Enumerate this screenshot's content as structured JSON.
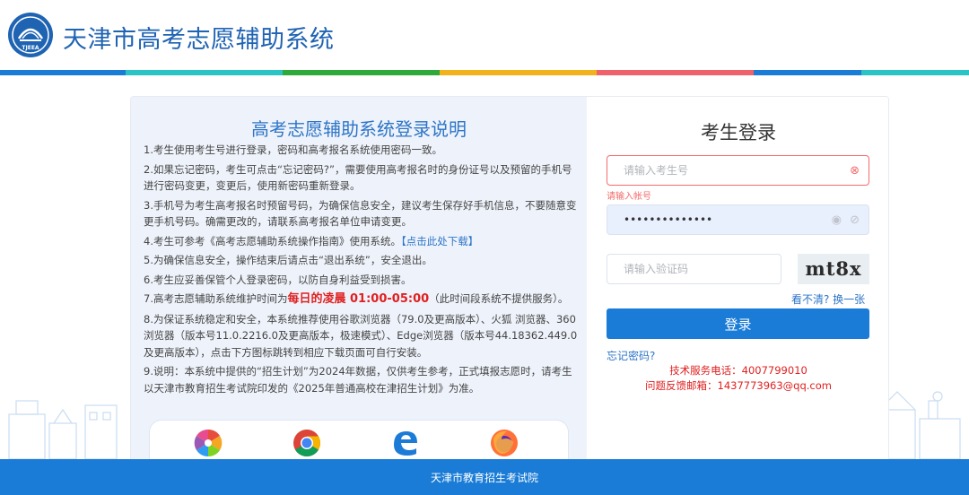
{
  "header": {
    "site_title": "天津市高考志愿辅助系统",
    "stripe_colors": [
      "#1a7cd6",
      "#2bc4c4",
      "#2eaa3a",
      "#f2b21b",
      "#f0626b",
      "#1a7cd6",
      "#2bc4c4"
    ]
  },
  "notice": {
    "title": "高考志愿辅助系统登录说明",
    "items": [
      "1.考生使用考生号进行登录，密码和高考报名系统使用密码一致。",
      "2.如果忘记密码，考生可点击“忘记密码?”，需要使用高考报名时的身份证号以及预留的手机号进行密码变更，变更后，使用新密码重新登录。",
      "3.手机号为考生高考报名时预留号码，为确保信息安全，建议考生保存好手机信息，不要随意变更手机号码。确需更改的，请联系高考报名单位申请变更。",
      "4.考生可参考《高考志愿辅助系统操作指南》使用系统。",
      "5.为确保信息安全，操作结束后请点击“退出系统”，安全退出。",
      "6.考生应妥善保管个人登录密码，以防自身利益受到损害。",
      "7.高考志愿辅助系统维护时间为",
      "8.为保证系统稳定和安全，本系统推荐使用谷歌浏览器（79.0及更高版本）、火狐 浏览器、360浏览器（版本号11.0.2216.0及更高版本，极速模式）、Edge浏览器（版本号44.18362.449.0及更高版本），点击下方图标跳转到相应下载页面可自行安装。",
      "9.说明：本系统中提供的“招生计划”为2024年数据，仅供考生参考，正式填报志愿时，请考生以天津市教育招生考试院印发的《2025年普通高校在津招生计划》为准。"
    ],
    "item4_link": "【点击此处下载】",
    "item7_highlight": "每日的凌晨 01:00-05:00",
    "item7_tail": "（此时间段系统不提供服务）。",
    "highlight_color": "#e02020"
  },
  "browsers": [
    "360-browser-icon",
    "chrome-icon",
    "edge-icon",
    "firefox-icon"
  ],
  "login": {
    "title": "考生登录",
    "username_placeholder": "请输入考生号",
    "username_error": "请输入帐号",
    "password_value": "••••••••••••••",
    "captcha_placeholder": "请输入验证码",
    "captcha_text": "mt8x",
    "refresh_label": "看不清? 换一张",
    "submit_label": "登录",
    "forgot_label": "忘记密码?",
    "support_phone": "技术服务电话：4007799010",
    "support_email": "问题反馈邮箱：1437773963@qq.com",
    "accent_color": "#1a7cd6"
  },
  "footer": {
    "text": "天津市教育招生考试院"
  }
}
